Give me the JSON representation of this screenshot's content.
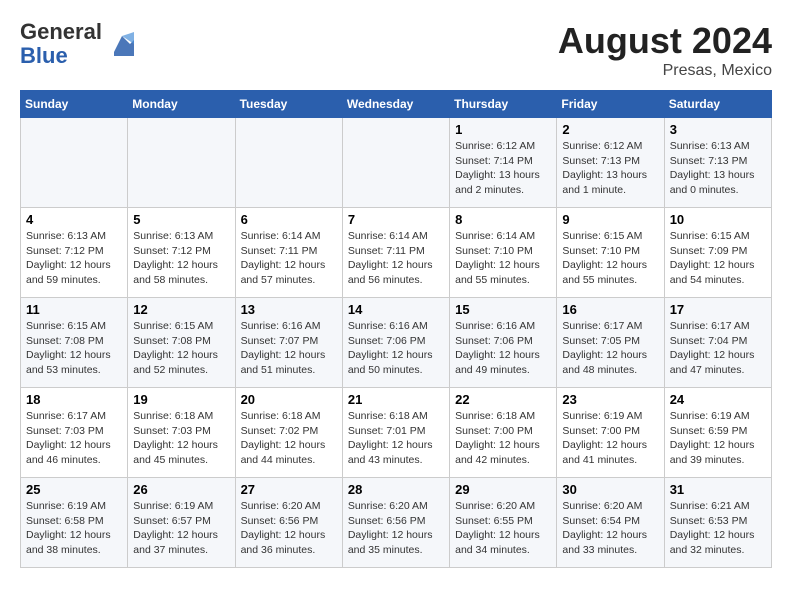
{
  "header": {
    "logo_line1": "General",
    "logo_line2": "Blue",
    "title": "August 2024",
    "subtitle": "Presas, Mexico"
  },
  "calendar": {
    "days_of_week": [
      "Sunday",
      "Monday",
      "Tuesday",
      "Wednesday",
      "Thursday",
      "Friday",
      "Saturday"
    ],
    "weeks": [
      [
        {
          "day": "",
          "info": ""
        },
        {
          "day": "",
          "info": ""
        },
        {
          "day": "",
          "info": ""
        },
        {
          "day": "",
          "info": ""
        },
        {
          "day": "1",
          "info": "Sunrise: 6:12 AM\nSunset: 7:14 PM\nDaylight: 13 hours\nand 2 minutes."
        },
        {
          "day": "2",
          "info": "Sunrise: 6:12 AM\nSunset: 7:13 PM\nDaylight: 13 hours\nand 1 minute."
        },
        {
          "day": "3",
          "info": "Sunrise: 6:13 AM\nSunset: 7:13 PM\nDaylight: 13 hours\nand 0 minutes."
        }
      ],
      [
        {
          "day": "4",
          "info": "Sunrise: 6:13 AM\nSunset: 7:12 PM\nDaylight: 12 hours\nand 59 minutes."
        },
        {
          "day": "5",
          "info": "Sunrise: 6:13 AM\nSunset: 7:12 PM\nDaylight: 12 hours\nand 58 minutes."
        },
        {
          "day": "6",
          "info": "Sunrise: 6:14 AM\nSunset: 7:11 PM\nDaylight: 12 hours\nand 57 minutes."
        },
        {
          "day": "7",
          "info": "Sunrise: 6:14 AM\nSunset: 7:11 PM\nDaylight: 12 hours\nand 56 minutes."
        },
        {
          "day": "8",
          "info": "Sunrise: 6:14 AM\nSunset: 7:10 PM\nDaylight: 12 hours\nand 55 minutes."
        },
        {
          "day": "9",
          "info": "Sunrise: 6:15 AM\nSunset: 7:10 PM\nDaylight: 12 hours\nand 55 minutes."
        },
        {
          "day": "10",
          "info": "Sunrise: 6:15 AM\nSunset: 7:09 PM\nDaylight: 12 hours\nand 54 minutes."
        }
      ],
      [
        {
          "day": "11",
          "info": "Sunrise: 6:15 AM\nSunset: 7:08 PM\nDaylight: 12 hours\nand 53 minutes."
        },
        {
          "day": "12",
          "info": "Sunrise: 6:15 AM\nSunset: 7:08 PM\nDaylight: 12 hours\nand 52 minutes."
        },
        {
          "day": "13",
          "info": "Sunrise: 6:16 AM\nSunset: 7:07 PM\nDaylight: 12 hours\nand 51 minutes."
        },
        {
          "day": "14",
          "info": "Sunrise: 6:16 AM\nSunset: 7:06 PM\nDaylight: 12 hours\nand 50 minutes."
        },
        {
          "day": "15",
          "info": "Sunrise: 6:16 AM\nSunset: 7:06 PM\nDaylight: 12 hours\nand 49 minutes."
        },
        {
          "day": "16",
          "info": "Sunrise: 6:17 AM\nSunset: 7:05 PM\nDaylight: 12 hours\nand 48 minutes."
        },
        {
          "day": "17",
          "info": "Sunrise: 6:17 AM\nSunset: 7:04 PM\nDaylight: 12 hours\nand 47 minutes."
        }
      ],
      [
        {
          "day": "18",
          "info": "Sunrise: 6:17 AM\nSunset: 7:03 PM\nDaylight: 12 hours\nand 46 minutes."
        },
        {
          "day": "19",
          "info": "Sunrise: 6:18 AM\nSunset: 7:03 PM\nDaylight: 12 hours\nand 45 minutes."
        },
        {
          "day": "20",
          "info": "Sunrise: 6:18 AM\nSunset: 7:02 PM\nDaylight: 12 hours\nand 44 minutes."
        },
        {
          "day": "21",
          "info": "Sunrise: 6:18 AM\nSunset: 7:01 PM\nDaylight: 12 hours\nand 43 minutes."
        },
        {
          "day": "22",
          "info": "Sunrise: 6:18 AM\nSunset: 7:00 PM\nDaylight: 12 hours\nand 42 minutes."
        },
        {
          "day": "23",
          "info": "Sunrise: 6:19 AM\nSunset: 7:00 PM\nDaylight: 12 hours\nand 41 minutes."
        },
        {
          "day": "24",
          "info": "Sunrise: 6:19 AM\nSunset: 6:59 PM\nDaylight: 12 hours\nand 39 minutes."
        }
      ],
      [
        {
          "day": "25",
          "info": "Sunrise: 6:19 AM\nSunset: 6:58 PM\nDaylight: 12 hours\nand 38 minutes."
        },
        {
          "day": "26",
          "info": "Sunrise: 6:19 AM\nSunset: 6:57 PM\nDaylight: 12 hours\nand 37 minutes."
        },
        {
          "day": "27",
          "info": "Sunrise: 6:20 AM\nSunset: 6:56 PM\nDaylight: 12 hours\nand 36 minutes."
        },
        {
          "day": "28",
          "info": "Sunrise: 6:20 AM\nSunset: 6:56 PM\nDaylight: 12 hours\nand 35 minutes."
        },
        {
          "day": "29",
          "info": "Sunrise: 6:20 AM\nSunset: 6:55 PM\nDaylight: 12 hours\nand 34 minutes."
        },
        {
          "day": "30",
          "info": "Sunrise: 6:20 AM\nSunset: 6:54 PM\nDaylight: 12 hours\nand 33 minutes."
        },
        {
          "day": "31",
          "info": "Sunrise: 6:21 AM\nSunset: 6:53 PM\nDaylight: 12 hours\nand 32 minutes."
        }
      ]
    ]
  }
}
